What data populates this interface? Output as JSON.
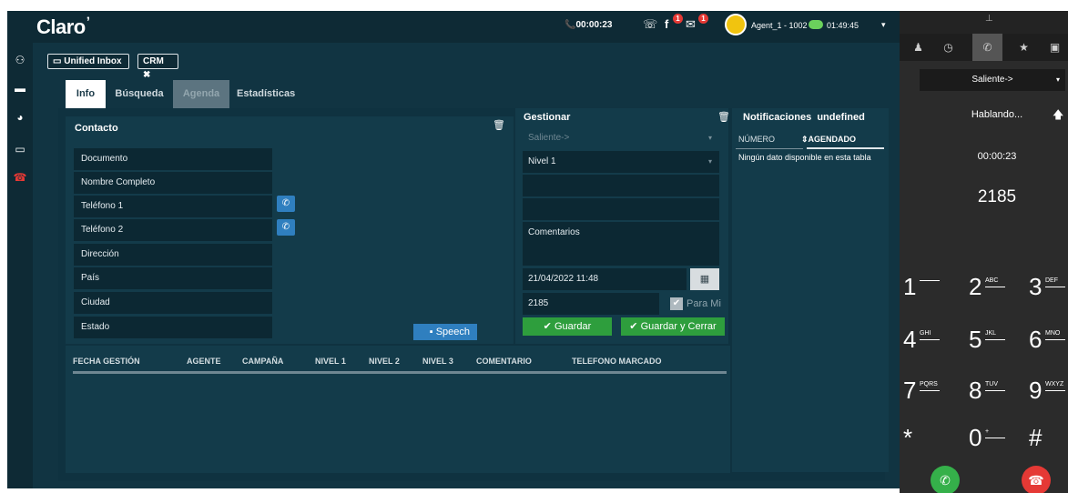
{
  "topbar": {
    "logo": "Claro",
    "call_timer": "📞00:00:23",
    "agent": "Agent_1 - 1002",
    "session_time": "01:49:45",
    "badges": {
      "facebook": "1",
      "mail": "1"
    }
  },
  "chips": {
    "inbox": "Unified Inbox",
    "crm": "CRM"
  },
  "tabs": {
    "info": "Info",
    "busqueda": "Búsqueda",
    "agenda": "Agenda",
    "estadisticas": "Estadísticas"
  },
  "contacto": {
    "title": "Contacto",
    "fields": [
      "Documento",
      "Nombre Completo",
      "Teléfono 1",
      "Teléfono 2",
      "Dirección",
      "País",
      "Ciudad",
      "Estado"
    ],
    "speech": "Speech"
  },
  "gestionar": {
    "title": "Gestionar",
    "direction": "Saliente->",
    "nivel": "Nivel 1",
    "comentarios": "Comentarios",
    "datetime": "21/04/2022 11:48",
    "phone": "2185",
    "para_mi": "Para Mi",
    "guardar": "Guardar",
    "guardar_cerrar": "Guardar y Cerrar"
  },
  "notificaciones": {
    "title": "Notificaciones",
    "title_suffix": "undefined",
    "col_numero": "NÚMERO",
    "col_agendado": "AGENDADO",
    "empty": "Ningún dato disponible en esta tabla"
  },
  "historial": {
    "columns": [
      "FECHA GESTIÓN",
      "AGENTE",
      "CAMPAÑA",
      "NIVEL 1",
      "NIVEL 2",
      "NIVEL 3",
      "COMENTARIO",
      "TELEFONO MARCADO"
    ]
  },
  "dialer": {
    "direction": "Saliente->",
    "status": "Hablando...",
    "timer": "00:00:23",
    "number": "2185",
    "keys": [
      {
        "d": "1",
        "s": ""
      },
      {
        "d": "2",
        "s": "ABC"
      },
      {
        "d": "3",
        "s": "DEF"
      },
      {
        "d": "4",
        "s": "GHI"
      },
      {
        "d": "5",
        "s": "JKL"
      },
      {
        "d": "6",
        "s": "MNO"
      },
      {
        "d": "7",
        "s": "PQRS"
      },
      {
        "d": "8",
        "s": "TUV"
      },
      {
        "d": "9",
        "s": "WXYZ"
      },
      {
        "d": "*",
        "s": ""
      },
      {
        "d": "0",
        "s": "+"
      },
      {
        "d": "#",
        "s": ""
      }
    ]
  }
}
